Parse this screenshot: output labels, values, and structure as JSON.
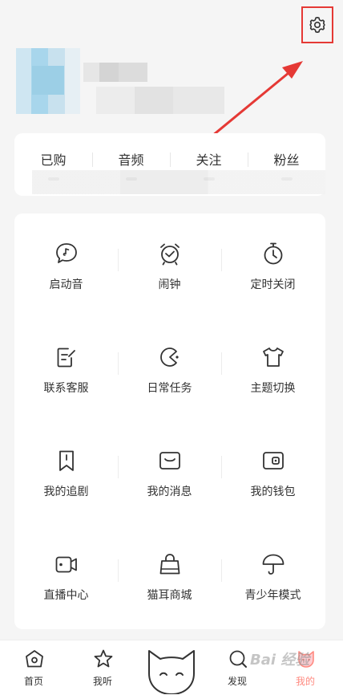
{
  "header": {
    "settings_icon": "gear-icon"
  },
  "stats": [
    {
      "label": "已购"
    },
    {
      "label": "音频"
    },
    {
      "label": "关注"
    },
    {
      "label": "粉丝"
    }
  ],
  "features": [
    {
      "label": "启动音",
      "icon": "speech-note-icon"
    },
    {
      "label": "闹钟",
      "icon": "alarm-clock-icon"
    },
    {
      "label": "定时关闭",
      "icon": "timer-icon"
    },
    {
      "label": "联系客服",
      "icon": "edit-note-icon"
    },
    {
      "label": "日常任务",
      "icon": "pacman-icon"
    },
    {
      "label": "主题切换",
      "icon": "tshirt-icon"
    },
    {
      "label": "我的追剧",
      "icon": "bookmark-icon"
    },
    {
      "label": "我的消息",
      "icon": "message-icon"
    },
    {
      "label": "我的钱包",
      "icon": "wallet-icon"
    },
    {
      "label": "直播中心",
      "icon": "video-camera-icon"
    },
    {
      "label": "猫耳商城",
      "icon": "shopping-bag-icon"
    },
    {
      "label": "青少年模式",
      "icon": "umbrella-icon"
    }
  ],
  "tabbar": {
    "items": [
      {
        "label": "首页",
        "icon": "home-icon"
      },
      {
        "label": "我听",
        "icon": "star-icon"
      },
      {
        "label": "发现",
        "icon": "search-icon"
      },
      {
        "label": "我的",
        "icon": "cat-icon"
      }
    ],
    "active_color": "#ff8a80"
  },
  "watermark": "Bai 经验"
}
